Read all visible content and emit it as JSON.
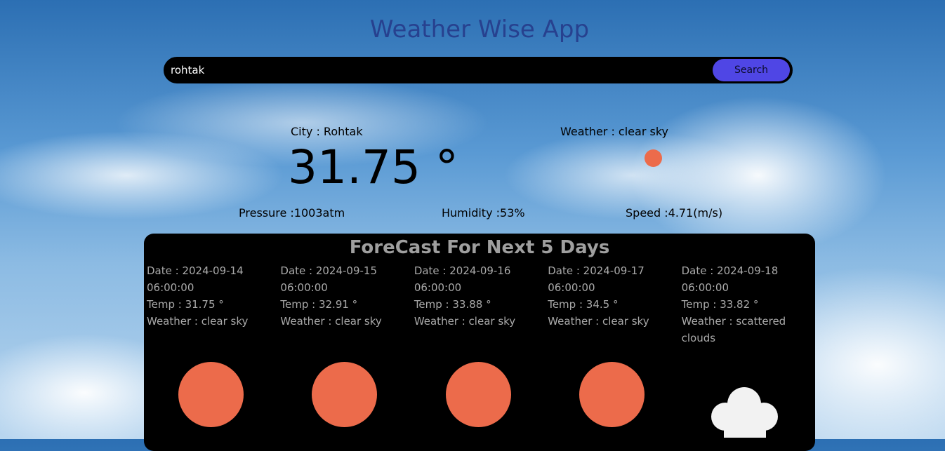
{
  "app": {
    "title": "Weather Wise App"
  },
  "search": {
    "value": "rohtak",
    "button_label": "Search"
  },
  "current": {
    "city": "City : Rohtak",
    "temperature": "31.75 °",
    "weather": "Weather : clear sky",
    "icon": "sun-icon",
    "pressure": "Pressure :1003atm",
    "humidity": "Humidity :53%",
    "speed": "Speed :4.71(m/s)"
  },
  "forecast": {
    "title": "ForeCast For Next 5 Days",
    "days": [
      {
        "date": "Date : 2024-09-14",
        "time": "06:00:00",
        "temp": "Temp : 31.75 °",
        "weather": "Weather : clear sky",
        "icon": "sun-icon"
      },
      {
        "date": "Date : 2024-09-15",
        "time": "06:00:00",
        "temp": "Temp : 32.91 °",
        "weather": "Weather : clear sky",
        "icon": "sun-icon"
      },
      {
        "date": "Date : 2024-09-16",
        "time": "06:00:00",
        "temp": "Temp : 33.88 °",
        "weather": "Weather : clear sky",
        "icon": "sun-icon"
      },
      {
        "date": "Date : 2024-09-17",
        "time": "06:00:00",
        "temp": "Temp : 34.5 °",
        "weather": "Weather : clear sky",
        "icon": "sun-icon"
      },
      {
        "date": "Date : 2024-09-18",
        "time": "06:00:00",
        "temp": "Temp : 33.82 °",
        "weather": "Weather : scattered clouds",
        "icon": "cloud-icon"
      }
    ]
  },
  "colors": {
    "sun": "#ec6b4b",
    "search_button": "#4f46e5",
    "title": "#27418f"
  }
}
